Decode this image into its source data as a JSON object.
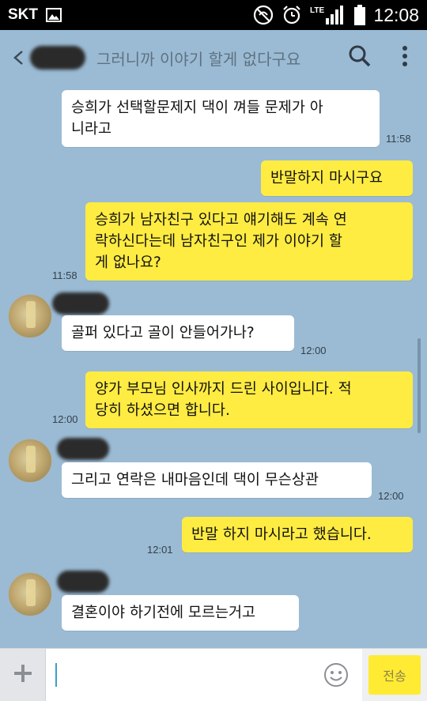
{
  "status_bar": {
    "carrier": "SKT",
    "lte": "LTE",
    "time": "12:08"
  },
  "header": {
    "preview_text": "그러니까 이야기 할게 없다구요"
  },
  "messages": [
    {
      "text_lines": [
        "승희가 선택할문제지 댁이 껴들 문제가 아",
        "니라고"
      ],
      "time": "11:58"
    },
    {
      "text_lines": [
        "반말하지 마시구요"
      ]
    },
    {
      "text_lines": [
        "승희가 남자친구 있다고 얘기해도 계속 연",
        "락하신다는데 남자친구인 제가 이야기 할",
        "게 없나요?"
      ],
      "time": "11:58"
    },
    {
      "text_lines": [
        "골퍼 있다고 골이 안들어가나?"
      ],
      "time": "12:00"
    },
    {
      "text_lines": [
        "양가 부모님 인사까지 드린 사이입니다. 적",
        "당히 하셨으면 합니다."
      ],
      "time": "12:00"
    },
    {
      "text_lines": [
        "그리고 연락은 내마음인데 댁이 무슨상관"
      ],
      "time": "12:00"
    },
    {
      "text_lines": [
        "반말 하지 마시라고 했습니다."
      ],
      "time": "12:01"
    },
    {
      "text_lines": [
        "결혼이야 하기전에 모르는거고"
      ]
    }
  ],
  "input": {
    "send_label": "전송"
  }
}
